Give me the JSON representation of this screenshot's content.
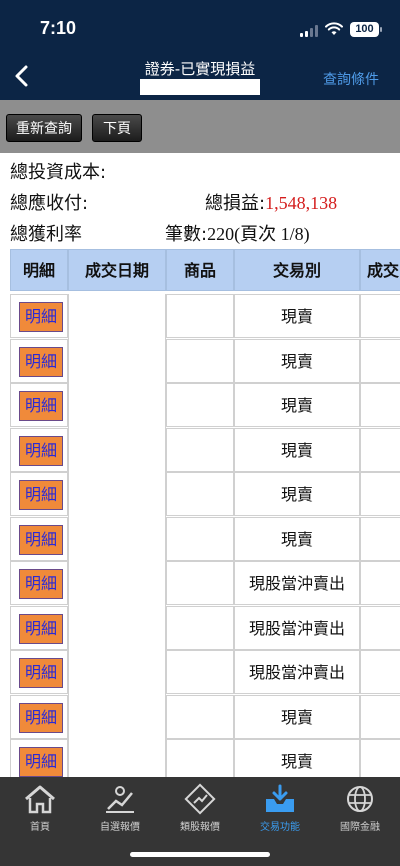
{
  "status": {
    "time": "7:10",
    "battery": "100"
  },
  "header": {
    "title": "證券-已實現損益",
    "query_conditions": "查詢條件"
  },
  "toolbar": {
    "requery": "重新查詢",
    "next_page": "下頁"
  },
  "summary": {
    "total_cost_label": "總投資成本:",
    "total_receivable_label": "總應收付:",
    "total_pnl_label": "總損益:",
    "total_pnl_value": "1,548,138",
    "total_return_label": "總獲利率",
    "count_label": "筆數:",
    "count_value": "220",
    "page_info": "(頁次 1/8)"
  },
  "table": {
    "headers": [
      "明細",
      "成交日期",
      "商品",
      "交易別",
      "成交"
    ],
    "detail_label": "明細",
    "rows": [
      {
        "type": "現賣"
      },
      {
        "type": "現賣"
      },
      {
        "type": "現賣"
      },
      {
        "type": "現賣"
      },
      {
        "type": "現賣"
      },
      {
        "type": "現賣"
      },
      {
        "type": "現股當沖賣出"
      },
      {
        "type": "現股當沖賣出"
      },
      {
        "type": "現股當沖賣出"
      },
      {
        "type": "現賣"
      },
      {
        "type": "現賣"
      }
    ]
  },
  "tabs": [
    {
      "label": "首頁",
      "icon": "home-icon"
    },
    {
      "label": "自選報價",
      "icon": "watchlist-icon"
    },
    {
      "label": "類股報價",
      "icon": "sector-quote-icon"
    },
    {
      "label": "交易功能",
      "icon": "trade-icon",
      "active": true
    },
    {
      "label": "國際金融",
      "icon": "globe-icon"
    }
  ],
  "colors": {
    "header_bg": "#0c2545",
    "accent": "#3a9cf0",
    "pnl": "#d41c1c",
    "table_header": "#b6cff2",
    "detail_button": "#f08a3a"
  }
}
